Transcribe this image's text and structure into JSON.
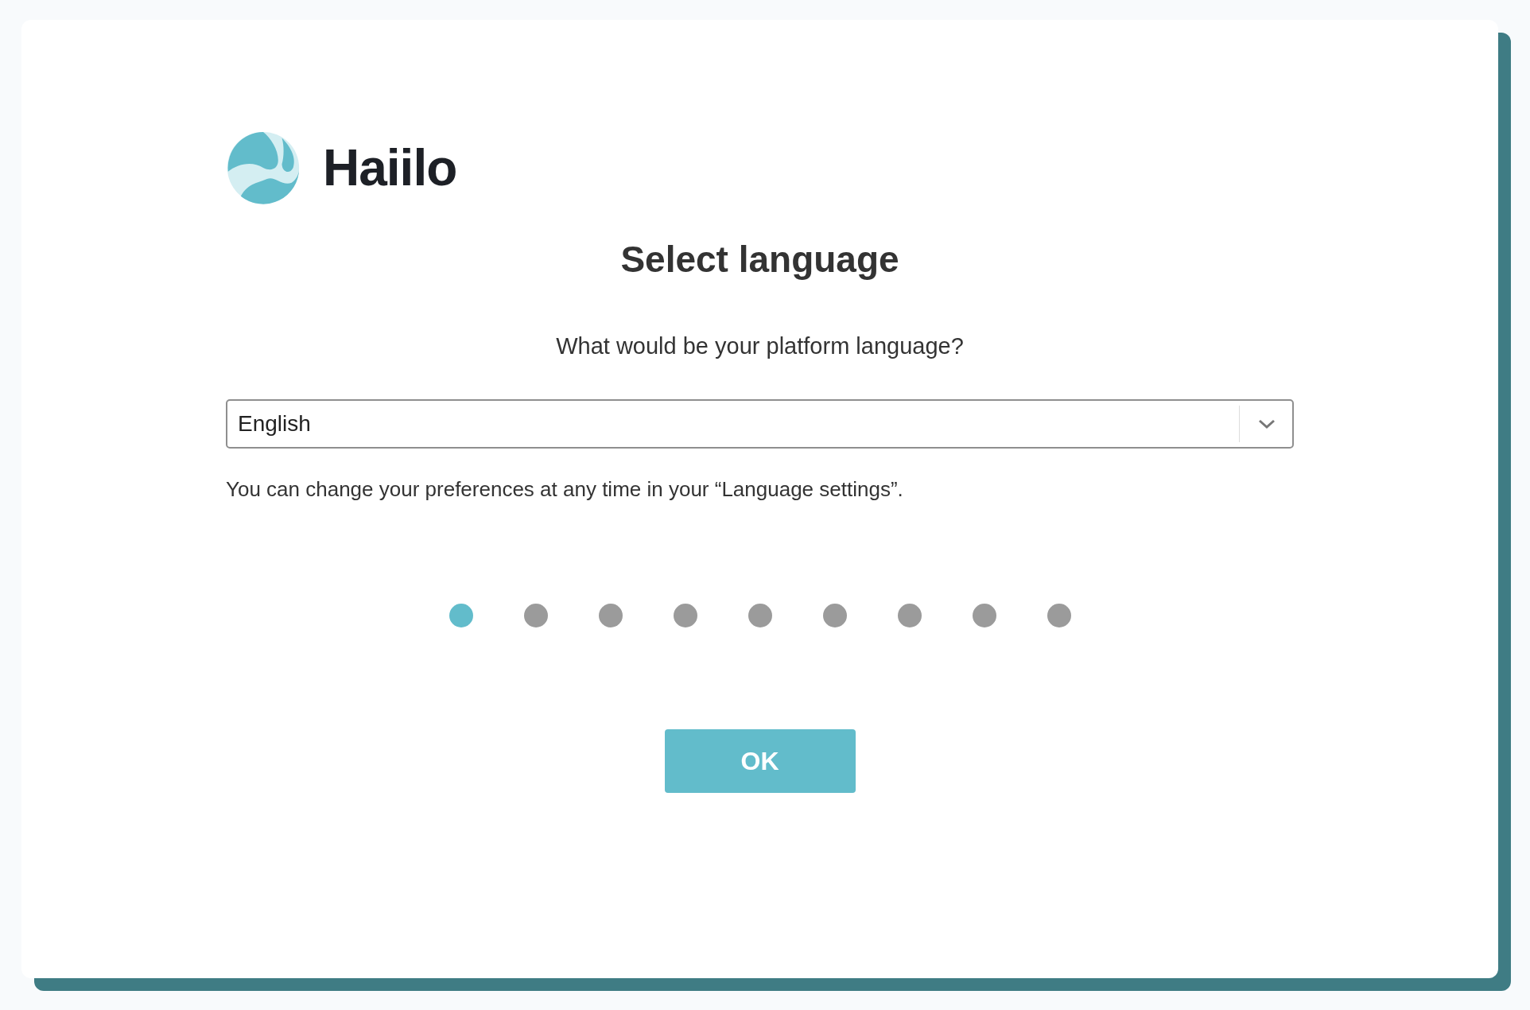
{
  "logo": {
    "text": "Haiilo"
  },
  "title": "Select language",
  "question": "What would be your platform language?",
  "language_select": {
    "value": "English"
  },
  "hint": "You can change your preferences at any time in your “Language settings”.",
  "steps": [
    {
      "selected": true
    },
    {
      "selected": false
    },
    {
      "selected": false
    },
    {
      "selected": false
    },
    {
      "selected": false
    },
    {
      "selected": false
    },
    {
      "selected": false
    },
    {
      "selected": false
    },
    {
      "selected": false
    }
  ],
  "buttons": [
    "OK"
  ]
}
